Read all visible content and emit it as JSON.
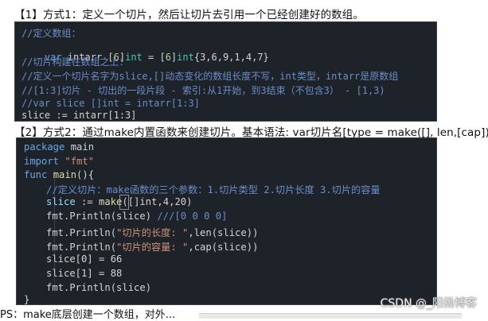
{
  "heading1": "【1】方式1：定义一个切片，然后让切片去引用一个已经创建好的数组。",
  "heading2": "【2】方式2：通过make内置函数来创建切片。基本语法: var切片名[type = make([], len,[cap])",
  "code1": {
    "l1": "//定义数组：",
    "l2": {
      "kw": "var",
      "rest1": " intarr [",
      "n1": "6",
      "rest2": "]",
      "ty1": "int",
      "rest3": " = [",
      "n2": "6",
      "rest4": "]",
      "ty2": "int",
      "rest5": "{3,6,9,1,4,7}"
    },
    "l3": "//切片构建在数组之上：",
    "l4": "//定义一个切片名字为slice,[]动态变化的数组长度不写，int类型，intarr是原数组",
    "l5": "//[1:3]切片 - 切出的一段片段 - 索引:从1开始，到3结束（不包含3） - [1,3)",
    "l6": "//var slice []int = intarr[1:3]",
    "l7": "slice := intarr[1:3]"
  },
  "code2": {
    "l1_kw": "package",
    "l1_rest": " main",
    "l2_kw": "import",
    "l2_str": " \"fmt\"",
    "l3_kw": "func",
    "l3_fn": " main",
    "l3_rest": "(){",
    "l4": "//定义切片：make函数的三个参数：1.切片类型 2.切片长度 3.切片的容量",
    "l5_var": "slice",
    "l5_op": " := ",
    "l5_fn": "make",
    "l5_rest": "([]int,4,20)",
    "l6_code": "fmt.Println(slice)",
    "l6_cm": " ///[0 0 0 0]",
    "l7_pre": "fmt.Println(",
    "l7_str": "\"切片的长度: \"",
    "l7_post": ",len(slice))",
    "l8_pre": "fmt.Println(",
    "l8_str": "\"切片的容量: \"",
    "l8_post": ",cap(slice))",
    "l9": "slice[0] = 66",
    "l10": "slice[1] = 88",
    "l11": "fmt.Println(slice)",
    "l12": "}"
  },
  "footer": "PS：make底层创建一个数组，对外...",
  "watermark": "CSDN @_阳扬博客"
}
